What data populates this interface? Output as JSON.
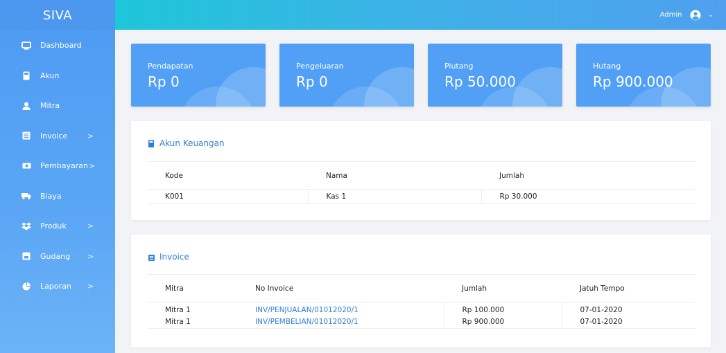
{
  "app": {
    "brand": "SIVA"
  },
  "sidebar": {
    "items": [
      {
        "label": "Dashboard",
        "icon": "monitor-icon",
        "chevron": false
      },
      {
        "label": "Akun",
        "icon": "calculator-icon",
        "chevron": false
      },
      {
        "label": "Mitra",
        "icon": "user-icon",
        "chevron": false
      },
      {
        "label": "Invoice",
        "icon": "receipt-icon",
        "chevron": true
      },
      {
        "label": "Pembayaran",
        "icon": "money-icon",
        "chevron": true
      },
      {
        "label": "Biaya",
        "icon": "truck-icon",
        "chevron": false
      },
      {
        "label": "Produk",
        "icon": "dropbox-icon",
        "chevron": true
      },
      {
        "label": "Gudang",
        "icon": "warehouse-icon",
        "chevron": true
      },
      {
        "label": "Laporan",
        "icon": "pie-chart-icon",
        "chevron": true
      }
    ],
    "chevron_glyph": ">"
  },
  "topbar": {
    "user_label": "Admin",
    "caret": "⌄"
  },
  "stats": [
    {
      "label": "Pendapatan",
      "value": "Rp 0"
    },
    {
      "label": "Pengeluaran",
      "value": "Rp 0"
    },
    {
      "label": "Piutang",
      "value": "Rp 50.000"
    },
    {
      "label": "Hutang",
      "value": "Rp 900.000"
    }
  ],
  "akun": {
    "title": "Akun Keuangan",
    "headers": [
      "Kode",
      "Nama",
      "Jumlah"
    ],
    "rows": [
      [
        "K001",
        "Kas 1",
        "Rp 30.000"
      ]
    ]
  },
  "invoice": {
    "title": "Invoice",
    "headers": [
      "Mitra",
      "No Invoice",
      "Jumlah",
      "Jatuh Tempo"
    ],
    "rows": [
      [
        "Mitra 1",
        "INV/PENJUALAN/01012020/1",
        "Rp 100.000",
        "07-01-2020"
      ],
      [
        "Mitra 1",
        "INV/PEMBELIAN/01012020/1",
        "Rp 900.000",
        "07-01-2020"
      ]
    ]
  },
  "colors": {
    "accent": "#51a0f5",
    "link": "#2f7fd8",
    "topbar_start": "#1ec6d9"
  }
}
